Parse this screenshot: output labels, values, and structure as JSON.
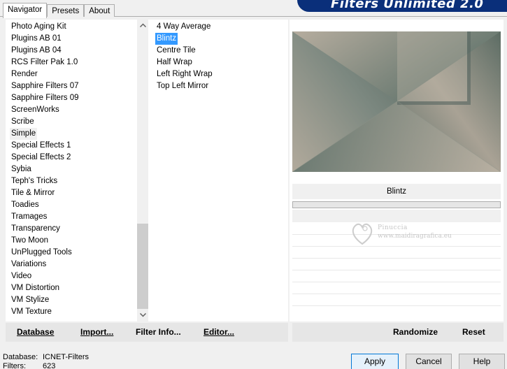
{
  "app": {
    "banner_title": "Filters Unlimited 2.0"
  },
  "tabs": [
    {
      "label": "Navigator",
      "active": true
    },
    {
      "label": "Presets",
      "active": false
    },
    {
      "label": "About",
      "active": false
    }
  ],
  "categories": {
    "items": [
      "Photo Aging Kit",
      "Plugins AB 01",
      "Plugins AB 04",
      "RCS Filter Pak 1.0",
      "Render",
      "Sapphire Filters 07",
      "Sapphire Filters 09",
      "ScreenWorks",
      "Scribe",
      "Simple",
      "Special Effects 1",
      "Special Effects 2",
      "Sybia",
      "Teph's Tricks",
      "Tile & Mirror",
      "Toadies",
      "Tramages",
      "Transparency",
      "Two Moon",
      "UnPlugged Tools",
      "Variations",
      "Video",
      "VM Distortion",
      "VM Stylize",
      "VM Texture"
    ],
    "selected": "Simple"
  },
  "effects": {
    "items": [
      "4 Way Average",
      "Blintz",
      "Centre Tile",
      "Half Wrap",
      "Left Right Wrap",
      "Top Left Mirror"
    ],
    "selected": "Blintz"
  },
  "preview": {
    "filter_name": "Blintz",
    "colors": {
      "light": "#b3ab9e",
      "dark": "#5e6e66",
      "mid": "#8c9088"
    }
  },
  "watermark": {
    "name": "Pinuccia",
    "url": "www.maidiragrafica.eu"
  },
  "toolbar_left": {
    "database": "Database",
    "import": "Import...",
    "filter_info": "Filter Info...",
    "editor": "Editor..."
  },
  "toolbar_right": {
    "randomize": "Randomize",
    "reset": "Reset"
  },
  "status": {
    "database_label": "Database:",
    "database_value": "ICNET-Filters",
    "filters_label": "Filters:",
    "filters_value": "623"
  },
  "dialog_buttons": {
    "apply": "Apply",
    "cancel": "Cancel",
    "help": "Help"
  },
  "icons": {
    "scroll_up": "chevron-up-icon",
    "scroll_down": "chevron-down-icon"
  }
}
